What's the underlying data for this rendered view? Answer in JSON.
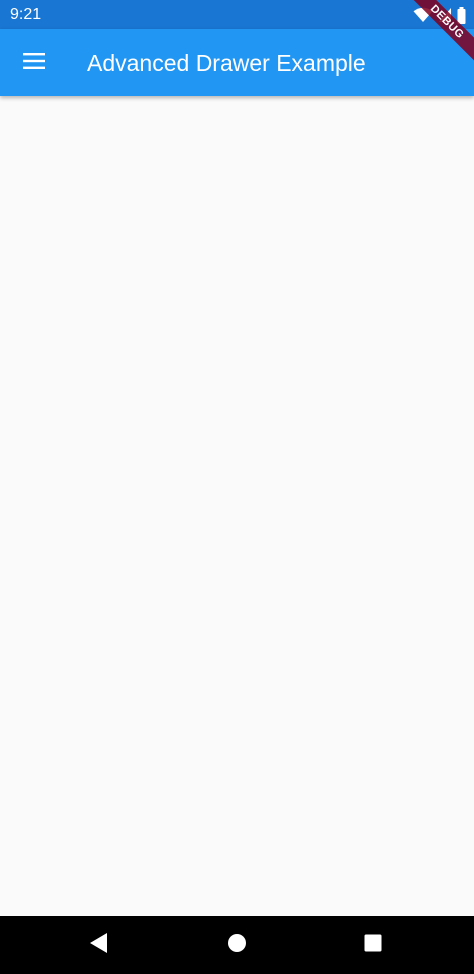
{
  "status_bar": {
    "time": "9:21",
    "icons": [
      "wifi-icon",
      "cell-signal-icon",
      "battery-icon"
    ],
    "color": "#1976D2"
  },
  "app_bar": {
    "title": "Advanced Drawer Example",
    "menu_icon": "hamburger-menu-icon",
    "color": "#2196F3"
  },
  "debug_banner": {
    "label": "DEBUG",
    "color": "#800020"
  },
  "nav_bar": {
    "buttons": [
      "back-icon",
      "home-icon",
      "recents-icon"
    ]
  },
  "theme": {
    "background": "#FAFAFA"
  }
}
